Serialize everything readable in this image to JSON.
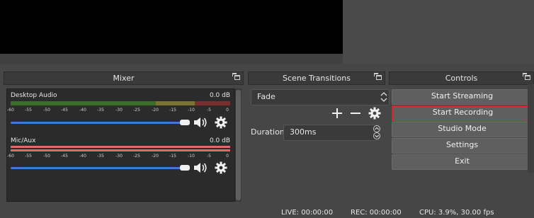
{
  "panels": {
    "mixer_title": "Mixer",
    "transitions_title": "Scene Transitions",
    "controls_title": "Controls"
  },
  "mixer": {
    "channels": [
      {
        "name": "Desktop Audio",
        "db": "0.0 dB",
        "muted": false
      },
      {
        "name": "Mic/Aux",
        "db": "0.0 dB",
        "muted": false
      }
    ],
    "scale": [
      "-60",
      "-55",
      "-50",
      "-45",
      "-40",
      "-35",
      "-30",
      "-25",
      "-20",
      "-15",
      "-10",
      "-5",
      "0"
    ]
  },
  "transitions": {
    "selected": "Fade",
    "duration_label": "Duration",
    "duration_value": "300ms",
    "add_icon": "plus-icon",
    "remove_icon": "minus-icon",
    "settings_icon": "gear-icon"
  },
  "controls": {
    "start_streaming": "Start Streaming",
    "start_recording": "Start Recording",
    "studio_mode": "Studio Mode",
    "settings": "Settings",
    "exit": "Exit"
  },
  "status": {
    "live": "LIVE: 00:00:00",
    "rec": "REC: 00:00:00",
    "cpu": "CPU: 3.9%, 30.00 fps"
  },
  "colors": {
    "meter_green": "#4caf2c",
    "meter_yellow": "#b8a832",
    "meter_red": "#c23b3b",
    "meter_pink": "#e26a6a",
    "slider_blue": "#3d7bd9",
    "highlight_red": "#e0202a"
  }
}
